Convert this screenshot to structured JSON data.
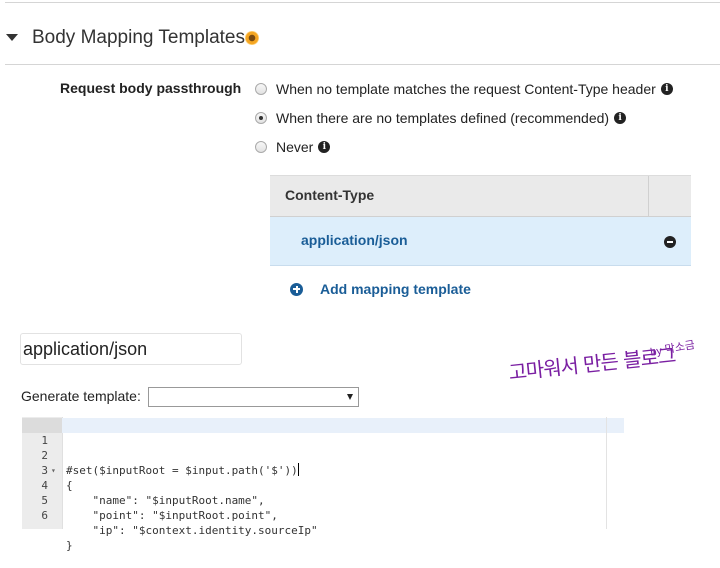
{
  "section": {
    "title": "Body Mapping Templates"
  },
  "passthrough": {
    "label": "Request body passthrough",
    "options": [
      {
        "label": "When no template matches the request Content-Type header",
        "checked": false
      },
      {
        "label": "When there are no templates defined (recommended)",
        "checked": true
      },
      {
        "label": "Never",
        "checked": false
      }
    ]
  },
  "content_type_table": {
    "header": "Content-Type",
    "rows": [
      {
        "label": "application/json",
        "selected": true
      }
    ]
  },
  "add_mapping_template_label": "Add mapping template",
  "content_type_input": {
    "value": "application/json"
  },
  "watermark": {
    "text": "고마워서 만든 블로그",
    "by": "by 막소금"
  },
  "generate_template": {
    "label": "Generate template:",
    "selected": ""
  },
  "editor": {
    "lines": [
      {
        "num": "1",
        "fold": "",
        "code": "#set($inputRoot = $input.path('$'))"
      },
      {
        "num": "2",
        "fold": "▾",
        "code": "{"
      },
      {
        "num": "3",
        "fold": "",
        "code": "    \"name\": \"$inputRoot.name\","
      },
      {
        "num": "4",
        "fold": "",
        "code": "    \"point\": \"$inputRoot.point\","
      },
      {
        "num": "5",
        "fold": "",
        "code": "    \"ip\": \"$context.identity.sourceIp\""
      },
      {
        "num": "6",
        "fold": "",
        "code": "}"
      }
    ]
  },
  "colors": {
    "link_blue": "#1a5d97",
    "selected_row": "#ddeefb",
    "table_header": "#eaeaea",
    "watermark": "#7a1fa2"
  }
}
